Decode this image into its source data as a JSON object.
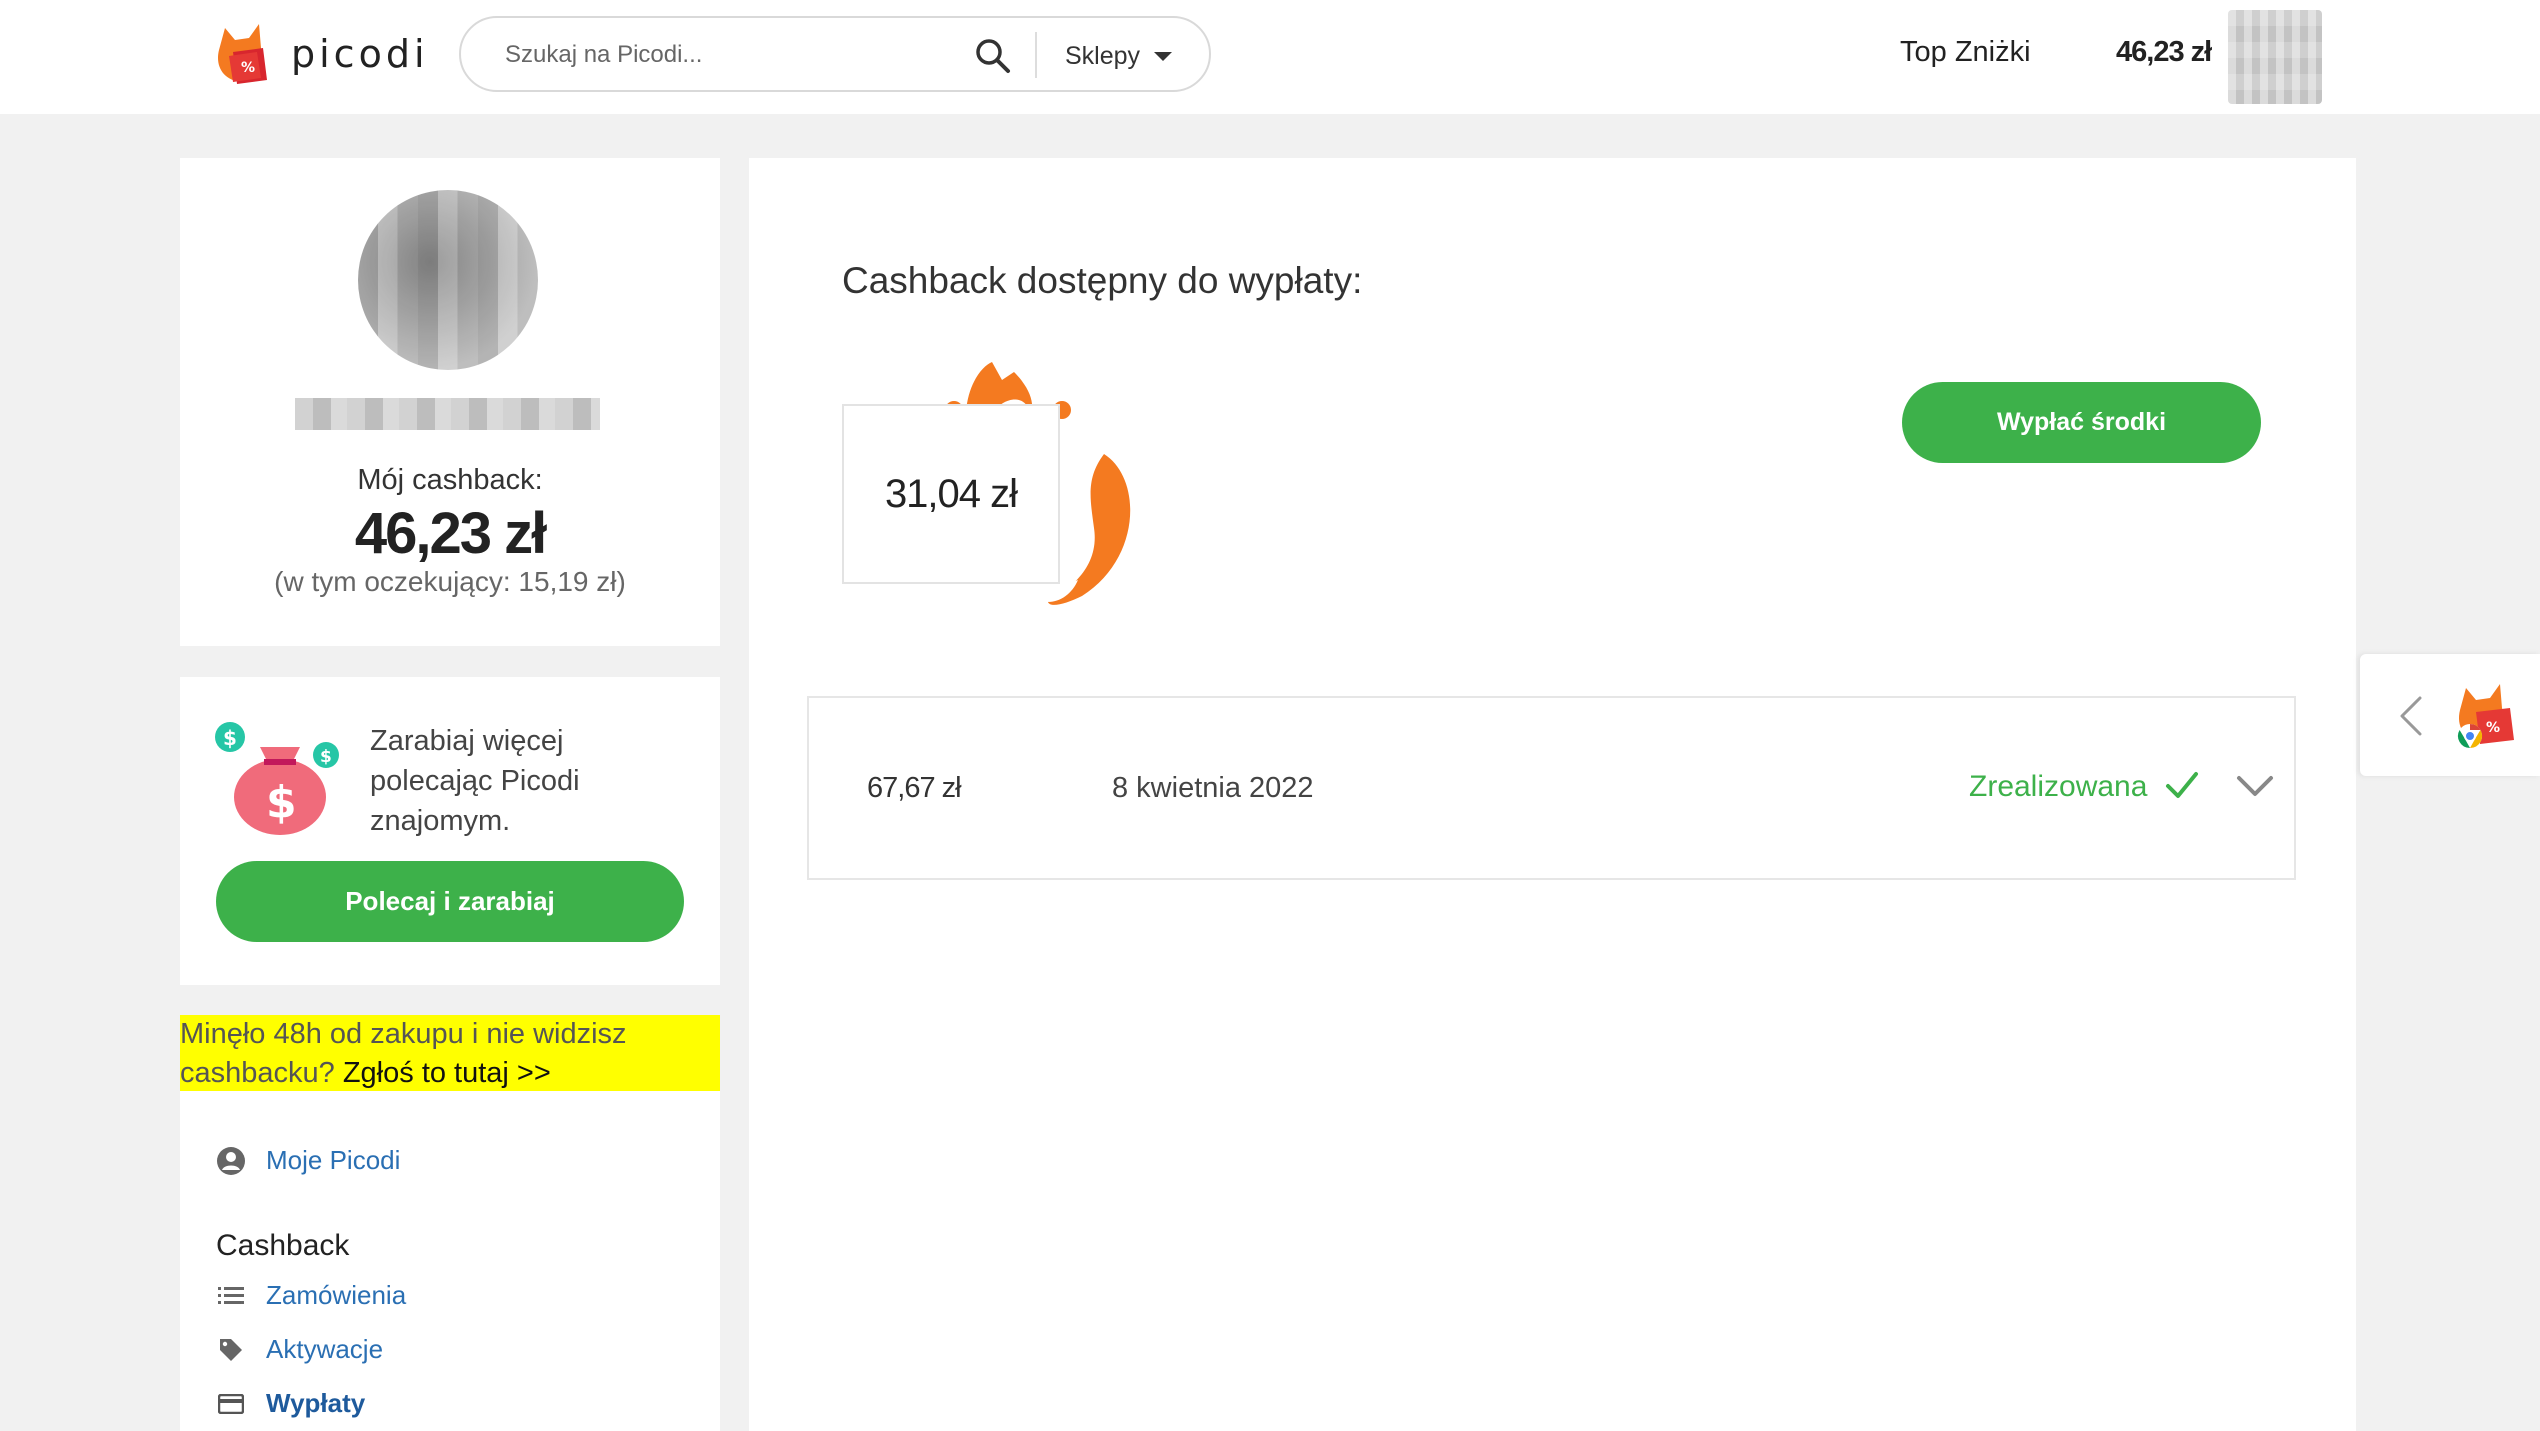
{
  "header": {
    "logo_text": "picodi",
    "search": {
      "placeholder": "Szukaj na Picodi..."
    },
    "shops_label": "Sklepy",
    "top_discounts_label": "Top Zniżki",
    "balance": "46,23 zł"
  },
  "profile": {
    "cashback_label": "Mój cashback:",
    "cashback_total": "46,23 zł",
    "cashback_pending": "(w tym oczekujący: 15,19 zł)"
  },
  "referral": {
    "text": "Zarabiaj więcej polecając Picodi znajomym.",
    "button_label": "Polecaj i zarabiaj"
  },
  "notice": {
    "text": "Minęło 48h od zakupu i nie widzisz cashbacku?",
    "link_text": "Zgłoś to tutaj >>"
  },
  "nav": {
    "my_picodi": "Moje Picodi",
    "cashback_heading": "Cashback",
    "orders": "Zamówienia",
    "activations": "Aktywacje",
    "payouts": "Wypłaty"
  },
  "main": {
    "available_heading": "Cashback dostępny do wypłaty:",
    "available_amount": "31,04 zł",
    "withdraw_button": "Wypłać środki",
    "payouts": [
      {
        "amount": "67,67 zł",
        "date": "8 kwietnia 2022",
        "status": "Zrealizowana"
      }
    ]
  },
  "colors": {
    "accent_green": "#3db14a",
    "link_blue": "#2a6fb3",
    "notice_yellow": "#ffff00",
    "fox_orange": "#f47a20"
  },
  "icons": [
    "search-icon",
    "chevron-down-icon",
    "user-circle-icon",
    "list-icon",
    "tag-icon",
    "credit-card-icon",
    "check-icon",
    "chevron-left-icon",
    "moneybag-icon"
  ]
}
